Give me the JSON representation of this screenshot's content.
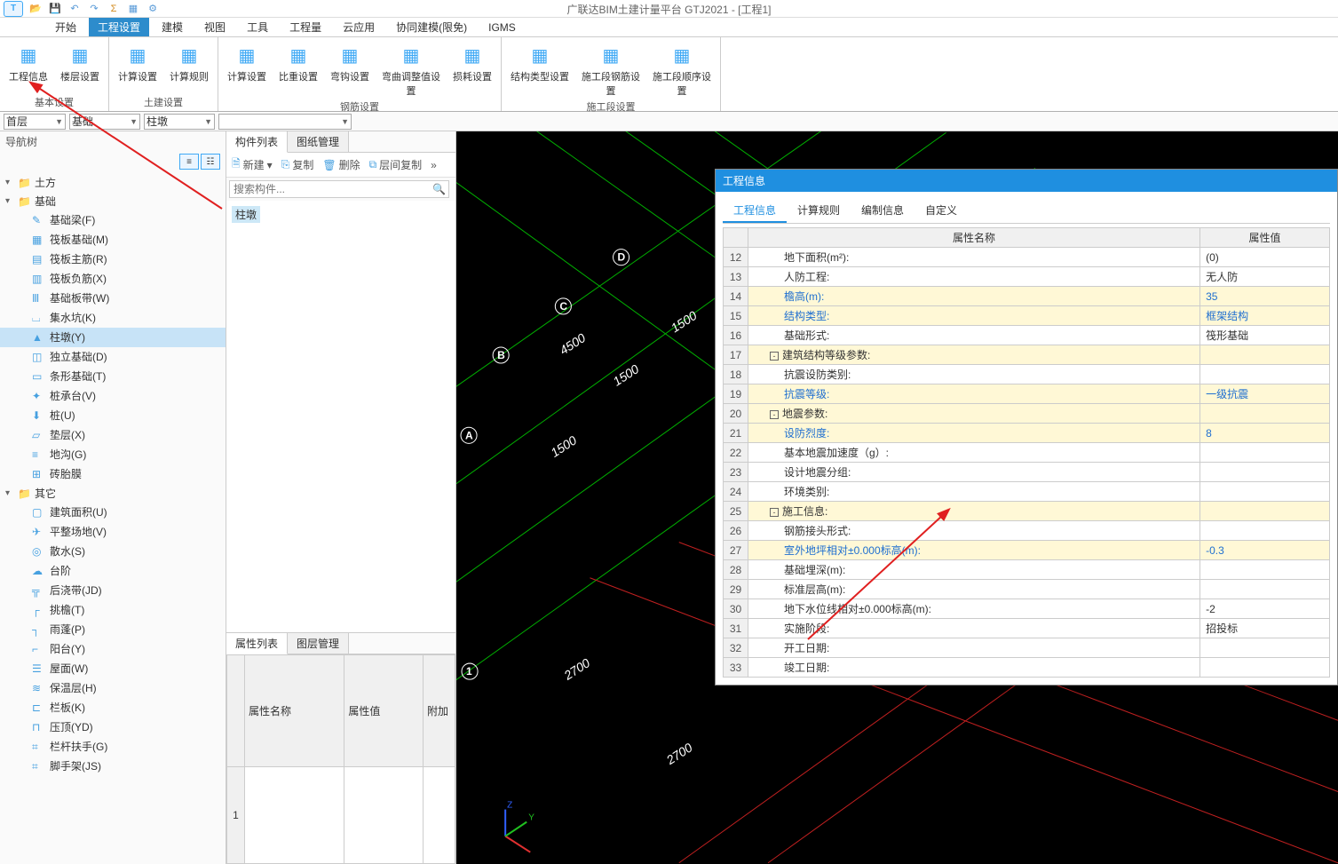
{
  "title": "广联达BIM土建计量平台 GTJ2021 - [工程1]",
  "menus": [
    "开始",
    "工程设置",
    "建模",
    "视图",
    "工具",
    "工程量",
    "云应用",
    "协同建模(限免)",
    "IGMS"
  ],
  "active_menu_index": 1,
  "ribbon": {
    "groups": [
      {
        "label": "基本设置",
        "buttons": [
          "工程信息",
          "楼层设置"
        ]
      },
      {
        "label": "土建设置",
        "buttons": [
          "计算设置",
          "计算规则"
        ]
      },
      {
        "label": "钢筋设置",
        "buttons": [
          "计算设置",
          "比重设置",
          "弯钩设置",
          "弯曲调整值设置",
          "损耗设置"
        ]
      },
      {
        "label": "施工段设置",
        "buttons": [
          "结构类型设置",
          "施工段钢筋设置",
          "施工段顺序设置"
        ]
      }
    ]
  },
  "context": {
    "floor": "首层",
    "cat": "基础",
    "subcat": "柱墩"
  },
  "nav_title": "导航树",
  "tree": [
    {
      "type": "group",
      "label": "土方"
    },
    {
      "type": "group",
      "label": "基础",
      "children": [
        {
          "label": "基础梁(F)",
          "icon": "✎"
        },
        {
          "label": "筏板基础(M)",
          "icon": "▦"
        },
        {
          "label": "筏板主筋(R)",
          "icon": "▤"
        },
        {
          "label": "筏板负筋(X)",
          "icon": "▥"
        },
        {
          "label": "基础板带(W)",
          "icon": "Ⅲ"
        },
        {
          "label": "集水坑(K)",
          "icon": "⌴"
        },
        {
          "label": "柱墩(Y)",
          "icon": "▲",
          "selected": true
        },
        {
          "label": "独立基础(D)",
          "icon": "◫"
        },
        {
          "label": "条形基础(T)",
          "icon": "▭"
        },
        {
          "label": "桩承台(V)",
          "icon": "✦"
        },
        {
          "label": "桩(U)",
          "icon": "⬇"
        },
        {
          "label": "垫层(X)",
          "icon": "▱"
        },
        {
          "label": "地沟(G)",
          "icon": "≡"
        },
        {
          "label": "砖胎膜",
          "icon": "⊞"
        }
      ]
    },
    {
      "type": "group",
      "label": "其它",
      "children": [
        {
          "label": "建筑面积(U)",
          "icon": "▢"
        },
        {
          "label": "平整场地(V)",
          "icon": "✈"
        },
        {
          "label": "散水(S)",
          "icon": "◎"
        },
        {
          "label": "台阶",
          "icon": "☁"
        },
        {
          "label": "后浇带(JD)",
          "icon": "╦"
        },
        {
          "label": "挑檐(T)",
          "icon": "┌"
        },
        {
          "label": "雨蓬(P)",
          "icon": "┐"
        },
        {
          "label": "阳台(Y)",
          "icon": "⌐"
        },
        {
          "label": "屋面(W)",
          "icon": "☰"
        },
        {
          "label": "保温层(H)",
          "icon": "≋"
        },
        {
          "label": "栏板(K)",
          "icon": "⊏"
        },
        {
          "label": "压顶(YD)",
          "icon": "⊓"
        },
        {
          "label": "栏杆扶手(G)",
          "icon": "⌗"
        },
        {
          "label": "脚手架(JS)",
          "icon": "⌗"
        }
      ]
    }
  ],
  "mid": {
    "tab1": "构件列表",
    "tab2": "图纸管理",
    "new": "新建",
    "copy": "复制",
    "del": "删除",
    "layercopy": "层间复制",
    "search_placeholder": "搜索构件...",
    "items": [
      "柱墩"
    ],
    "prop_tab1": "属性列表",
    "prop_tab2": "图层管理",
    "prop_head": [
      "",
      "属性名称",
      "属性值",
      "附加"
    ]
  },
  "dialog": {
    "title": "工程信息",
    "tabs": [
      "工程信息",
      "计算规则",
      "编制信息",
      "自定义"
    ],
    "head_name": "属性名称",
    "head_value": "属性值",
    "rows": [
      {
        "n": 12,
        "name": "地下面积(m²):",
        "val": "(0)",
        "indent": 2
      },
      {
        "n": 13,
        "name": "人防工程:",
        "val": "无人防",
        "indent": 2
      },
      {
        "n": 14,
        "name": "檐高(m):",
        "val": "35",
        "indent": 2,
        "link": true,
        "ylw": true
      },
      {
        "n": 15,
        "name": "结构类型:",
        "val": "框架结构",
        "indent": 2,
        "link": true,
        "ylw": true
      },
      {
        "n": 16,
        "name": "基础形式:",
        "val": "筏形基础",
        "indent": 2
      },
      {
        "n": 17,
        "name": "建筑结构等级参数:",
        "val": "",
        "indent": 1,
        "ylw": true,
        "exp": "-"
      },
      {
        "n": 18,
        "name": "抗震设防类别:",
        "val": "",
        "indent": 2
      },
      {
        "n": 19,
        "name": "抗震等级:",
        "val": "一级抗震",
        "indent": 2,
        "link": true,
        "ylw": true
      },
      {
        "n": 20,
        "name": "地震参数:",
        "val": "",
        "indent": 1,
        "ylw": true,
        "exp": "-"
      },
      {
        "n": 21,
        "name": "设防烈度:",
        "val": "8",
        "indent": 2,
        "link": true,
        "ylw": true
      },
      {
        "n": 22,
        "name": "基本地震加速度（g）:",
        "val": "",
        "indent": 2
      },
      {
        "n": 23,
        "name": "设计地震分组:",
        "val": "",
        "indent": 2
      },
      {
        "n": 24,
        "name": "环境类别:",
        "val": "",
        "indent": 2
      },
      {
        "n": 25,
        "name": "施工信息:",
        "val": "",
        "indent": 1,
        "ylw": true,
        "exp": "-"
      },
      {
        "n": 26,
        "name": "钢筋接头形式:",
        "val": "",
        "indent": 2
      },
      {
        "n": 27,
        "name": "室外地坪相对±0.000标高(m):",
        "val": "-0.3",
        "indent": 2,
        "link": true,
        "ylw": true
      },
      {
        "n": 28,
        "name": "基础埋深(m):",
        "val": "",
        "indent": 2
      },
      {
        "n": 29,
        "name": "标准层高(m):",
        "val": "",
        "indent": 2
      },
      {
        "n": 30,
        "name": "地下水位线相对±0.000标高(m):",
        "val": "-2",
        "indent": 2
      },
      {
        "n": 31,
        "name": "实施阶段:",
        "val": "招投标",
        "indent": 2
      },
      {
        "n": 32,
        "name": "开工日期:",
        "val": "",
        "indent": 2
      },
      {
        "n": 33,
        "name": "竣工日期:",
        "val": "",
        "indent": 2
      }
    ]
  },
  "canvas": {
    "labels": [
      "A",
      "B",
      "C",
      "D",
      "1"
    ],
    "dims": [
      "4500",
      "1500",
      "1500",
      "1500",
      "2700",
      "2700"
    ]
  }
}
